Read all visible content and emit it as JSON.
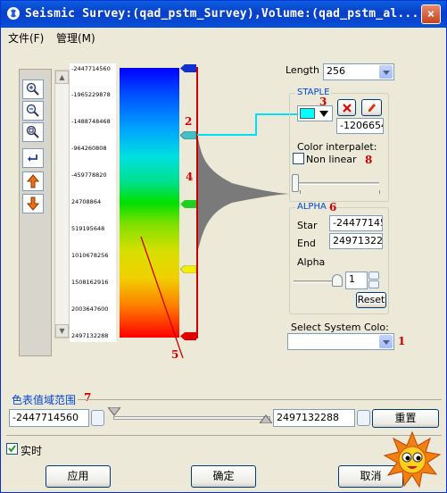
{
  "window": {
    "title": "Seismic Survey:(qad_pstm_Survey),Volume:(qad_pstm_al...",
    "close_glyph": "×"
  },
  "menu": [
    {
      "label": "文件(F)"
    },
    {
      "label": "管理(M)"
    }
  ],
  "colorbar": {
    "ticks": [
      "-2447714560",
      "-1965229878",
      "-1488748468",
      "-964260808",
      "-459778820",
      "24708864",
      "519195648",
      "1010678256",
      "1508162916",
      "2003647600",
      "2497132288"
    ]
  },
  "annotations": {
    "n1": "1",
    "n2": "2",
    "n3": "3",
    "n4": "4",
    "n5": "5",
    "n6": "6",
    "n7": "7",
    "n8": "8"
  },
  "length": {
    "label": "Length",
    "value": "256"
  },
  "staple": {
    "title": "STAPLE",
    "value": "-1206654",
    "selected_color": "#00ffff",
    "interpolate_label": "Color interpalet:",
    "nonlinear_label": "Non linear"
  },
  "alpha": {
    "title": "ALPHA",
    "start_label": "Star",
    "start_value": "-24477145",
    "end_label": "End",
    "end_value": "249713228",
    "alpha_label": "Alpha",
    "alpha_value": "1",
    "reset_label": "Reset"
  },
  "system_color": {
    "label": "Select System Colo:",
    "value": ""
  },
  "range": {
    "title": "色表值域范围",
    "min": "-2447714560",
    "max": "2497132288",
    "reset_label": "重置"
  },
  "realtime": {
    "label": "实时",
    "checked": true
  },
  "buttons": {
    "apply": "应用",
    "ok": "确定",
    "cancel": "取消"
  },
  "colors": {
    "accent_red": "#d00000",
    "cyan": "#00ffff",
    "title_blue": "#0046d5"
  }
}
